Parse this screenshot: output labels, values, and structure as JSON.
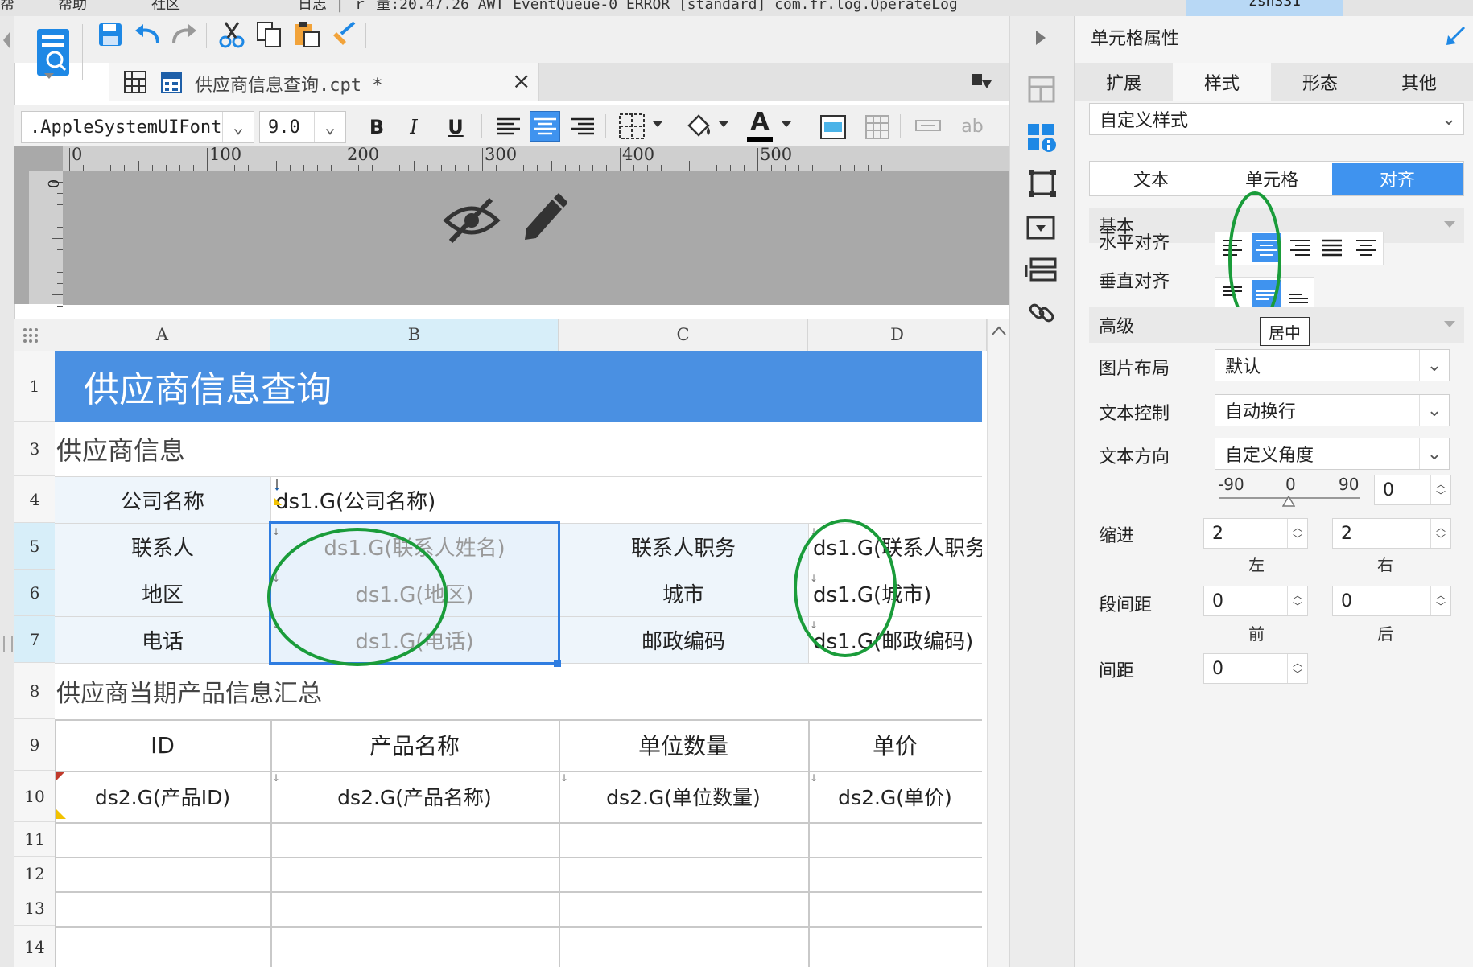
{
  "top_strip": {
    "left_text_1": "帮",
    "left_text_2": "帮助",
    "left_text_3": "社区",
    "log_text": "日志 | ｒ 量:20.47.26 AWT EventQueue-0 ERROR [standard] com.fr.log.OperateLog",
    "user": "zsh331"
  },
  "tab": {
    "filename": "供应商信息查询.cpt *",
    "close": "×"
  },
  "fontbar": {
    "font": ".AppleSystemUIFont",
    "size": "9.0",
    "bold": "B",
    "italic": "I",
    "underline": "U",
    "font_color_glyph": "A",
    "ab_label": "ab"
  },
  "ruler": {
    "marks": [
      "0",
      "100",
      "200",
      "300",
      "400",
      "500"
    ],
    "vertical_zero": "0"
  },
  "columns": [
    "A",
    "B",
    "C",
    "D"
  ],
  "rows": [
    "1",
    "3",
    "4",
    "5",
    "6",
    "7",
    "8",
    "9",
    "10",
    "11",
    "12",
    "13",
    "14"
  ],
  "sheet": {
    "title": "供应商信息查询",
    "section1": "供应商信息",
    "company_label": "公司名称",
    "company_value": "ds1.G(公司名称)",
    "contact_label": "联系人",
    "contact_value": "ds1.G(联系人姓名)",
    "contact_title_label": "联系人职务",
    "contact_title_value": "ds1.G(联系人职务",
    "region_label": "地区",
    "region_value": "ds1.G(地区)",
    "city_label": "城市",
    "city_value": "ds1.G(城市)",
    "phone_label": "电话",
    "phone_value": "ds1.G(电话)",
    "postcode_label": "邮政编码",
    "postcode_value": "ds1.G(邮政编码)",
    "section2": "供应商当期产品信息汇总",
    "headers": [
      "ID",
      "产品名称",
      "单位数量",
      "单价"
    ],
    "data_row": [
      "ds2.G(产品ID)",
      "ds2.G(产品名称)",
      "ds2.G(单位数量)",
      "ds2.G(单价)"
    ]
  },
  "panel": {
    "title": "单元格属性",
    "tabs": [
      "扩展",
      "样式",
      "形态",
      "其他"
    ],
    "active_tab": "样式",
    "style_select": "自定义样式",
    "segments": [
      "文本",
      "单元格",
      "对齐"
    ],
    "active_segment": "对齐",
    "basic": "基本",
    "h_align_label": "水平对齐",
    "v_align_label": "垂直对齐",
    "advanced": "高级",
    "tooltip": "居中",
    "image_layout_label": "图片布局",
    "image_layout_value": "默认",
    "text_control_label": "文本控制",
    "text_control_value": "自动换行",
    "text_dir_label": "文本方向",
    "text_dir_value": "自定义角度",
    "angle_min": "-90",
    "angle_mid": "0",
    "angle_max": "90",
    "angle_value": "0",
    "indent_label": "缩进",
    "indent_left": "2",
    "indent_right": "2",
    "left_label": "左",
    "right_label": "右",
    "para_label": "段间距",
    "para_before": "0",
    "para_after": "0",
    "before_label": "前",
    "after_label": "后",
    "spacing_label": "间距",
    "spacing_value": "0"
  },
  "colors": {
    "title_fill": "#4a90e2",
    "accent": "#3f93ef",
    "annotation": "#1a9c3a",
    "selection_border": "#2f7de1"
  }
}
